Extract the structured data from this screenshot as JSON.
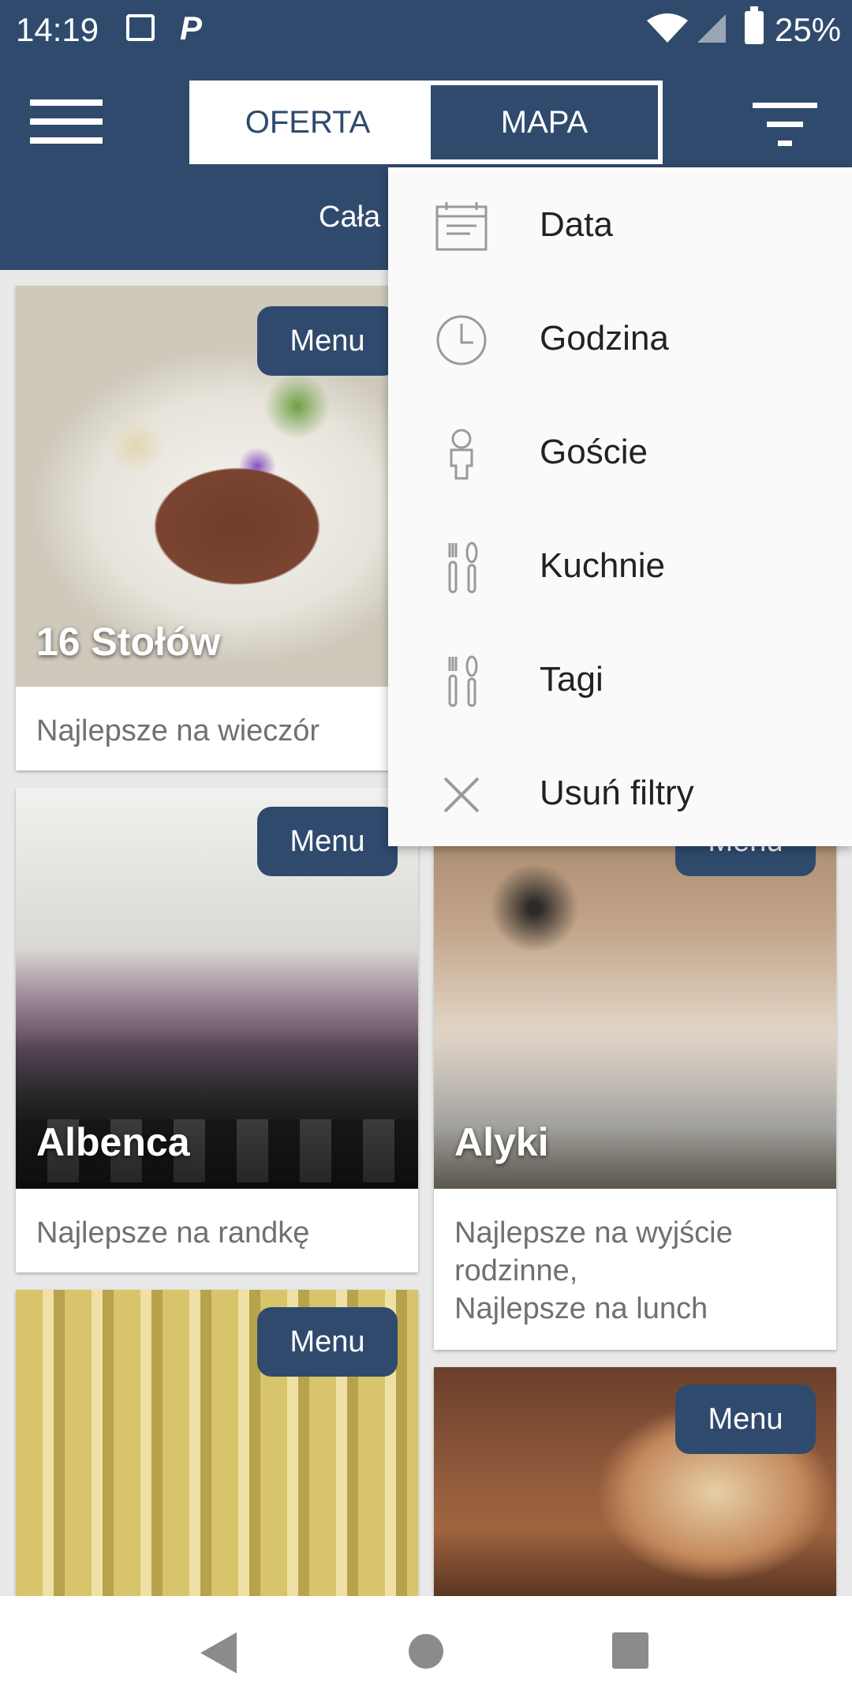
{
  "status_bar": {
    "time": "14:19",
    "battery": "25%"
  },
  "header": {
    "tabs": [
      {
        "label": "OFERTA",
        "active": false
      },
      {
        "label": "MAPA",
        "active": true
      }
    ],
    "subtitle": "Cała"
  },
  "cards": [
    {
      "name": "16 Stołów",
      "description": "Najlepsze na wieczór",
      "menu_label": "Menu"
    },
    {
      "name": "Albenca",
      "description": "Najlepsze na randkę",
      "menu_label": "Menu"
    },
    {
      "name": "Alyki",
      "description": "Najlepsze na wyjście rodzinne,\nNajlepsze na lunch",
      "menu_label": "Menu"
    },
    {
      "name": "",
      "description": "",
      "menu_label": "Menu"
    },
    {
      "name": "",
      "description": "",
      "menu_label": "Menu"
    }
  ],
  "dropdown": {
    "items": [
      {
        "label": "Data",
        "icon": "calendar-icon"
      },
      {
        "label": "Godzina",
        "icon": "clock-icon"
      },
      {
        "label": "Goście",
        "icon": "person-icon"
      },
      {
        "label": "Kuchnie",
        "icon": "cutlery-icon"
      },
      {
        "label": "Tagi",
        "icon": "cutlery-icon"
      },
      {
        "label": "Usuń filtry",
        "icon": "close-icon"
      }
    ]
  },
  "colors": {
    "primary": "#2f4a6d",
    "menu_bg": "#fafafa"
  }
}
